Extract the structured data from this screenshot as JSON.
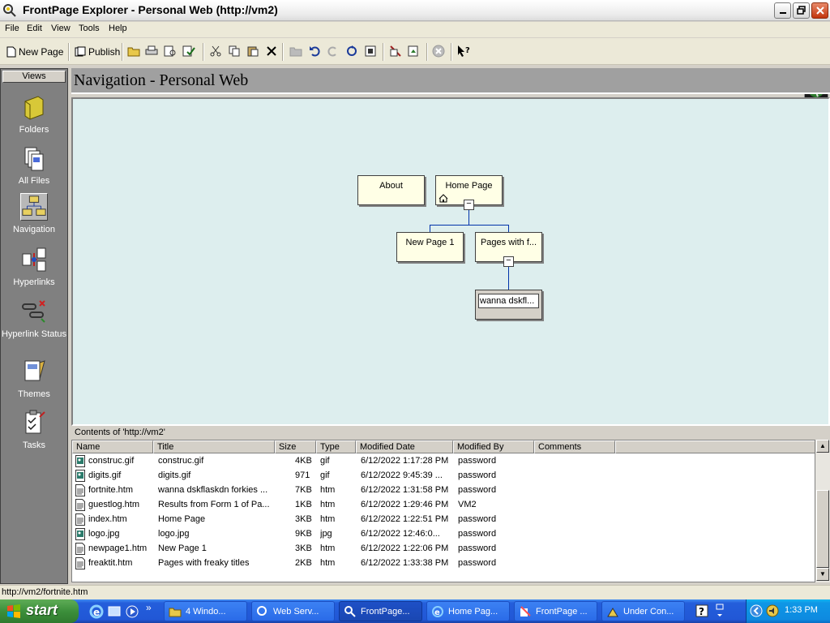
{
  "window": {
    "title": "FrontPage Explorer - Personal Web (http://vm2)"
  },
  "menu": [
    "File",
    "Edit",
    "View",
    "Tools",
    "Help"
  ],
  "toolbar": {
    "new_page": "New Page",
    "publish": "Publish"
  },
  "views": {
    "header": "Views",
    "items": [
      {
        "label": "Folders",
        "icon": "folder-icon"
      },
      {
        "label": "All Files",
        "icon": "all-files-icon"
      },
      {
        "label": "Navigation",
        "icon": "navigation-icon",
        "active": true
      },
      {
        "label": "Hyperlinks",
        "icon": "hyperlinks-icon"
      },
      {
        "label": "Hyperlink Status",
        "icon": "hyperlink-status-icon"
      },
      {
        "label": "Themes",
        "icon": "themes-icon"
      },
      {
        "label": "Tasks",
        "icon": "tasks-icon"
      }
    ]
  },
  "nav": {
    "header": "Navigation - Personal Web",
    "boxes": {
      "about": "About",
      "home": "Home Page",
      "newpage1": "New Page 1",
      "pages": "Pages with f...",
      "wanna": "wanna dskfl..."
    }
  },
  "files": {
    "title": "Contents of 'http://vm2'",
    "columns": [
      "Name",
      "Title",
      "Size",
      "Type",
      "Modified Date",
      "Modified By",
      "Comments"
    ],
    "rows": [
      {
        "name": "construc.gif",
        "title": "construc.gif",
        "size": "4KB",
        "type": "gif",
        "date": "6/12/2022 1:17:28 PM",
        "by": "password",
        "kind": "image"
      },
      {
        "name": "digits.gif",
        "title": "digits.gif",
        "size": "971",
        "type": "gif",
        "date": "6/12/2022 9:45:39 ...",
        "by": "password",
        "kind": "image"
      },
      {
        "name": "fortnite.htm",
        "title": "wanna dskflaskdn forkies ...",
        "size": "7KB",
        "type": "htm",
        "date": "6/12/2022 1:31:58 PM",
        "by": "password",
        "kind": "page"
      },
      {
        "name": "guestlog.htm",
        "title": "Results from Form 1 of Pa...",
        "size": "1KB",
        "type": "htm",
        "date": "6/12/2022 1:29:46 PM",
        "by": "VM2",
        "kind": "page"
      },
      {
        "name": "index.htm",
        "title": "Home Page",
        "size": "3KB",
        "type": "htm",
        "date": "6/12/2022 1:22:51 PM",
        "by": "password",
        "kind": "page"
      },
      {
        "name": "logo.jpg",
        "title": "logo.jpg",
        "size": "9KB",
        "type": "jpg",
        "date": "6/12/2022 12:46:0...",
        "by": "password",
        "kind": "image"
      },
      {
        "name": "newpage1.htm",
        "title": "New Page 1",
        "size": "3KB",
        "type": "htm",
        "date": "6/12/2022 1:22:06 PM",
        "by": "password",
        "kind": "page"
      },
      {
        "name": "freaktit.htm",
        "title": "Pages with freaky titles",
        "size": "2KB",
        "type": "htm",
        "date": "6/12/2022 1:33:38 PM",
        "by": "password",
        "kind": "page"
      }
    ]
  },
  "status": {
    "text": "http://vm2/fortnite.htm"
  },
  "taskbar": {
    "start": "start",
    "tasks": [
      "4 Windo...",
      "Web Serv...",
      "FrontPage...",
      "Home Pag...",
      "FrontPage ...",
      "Under Con..."
    ],
    "clock": "1:33 PM"
  }
}
